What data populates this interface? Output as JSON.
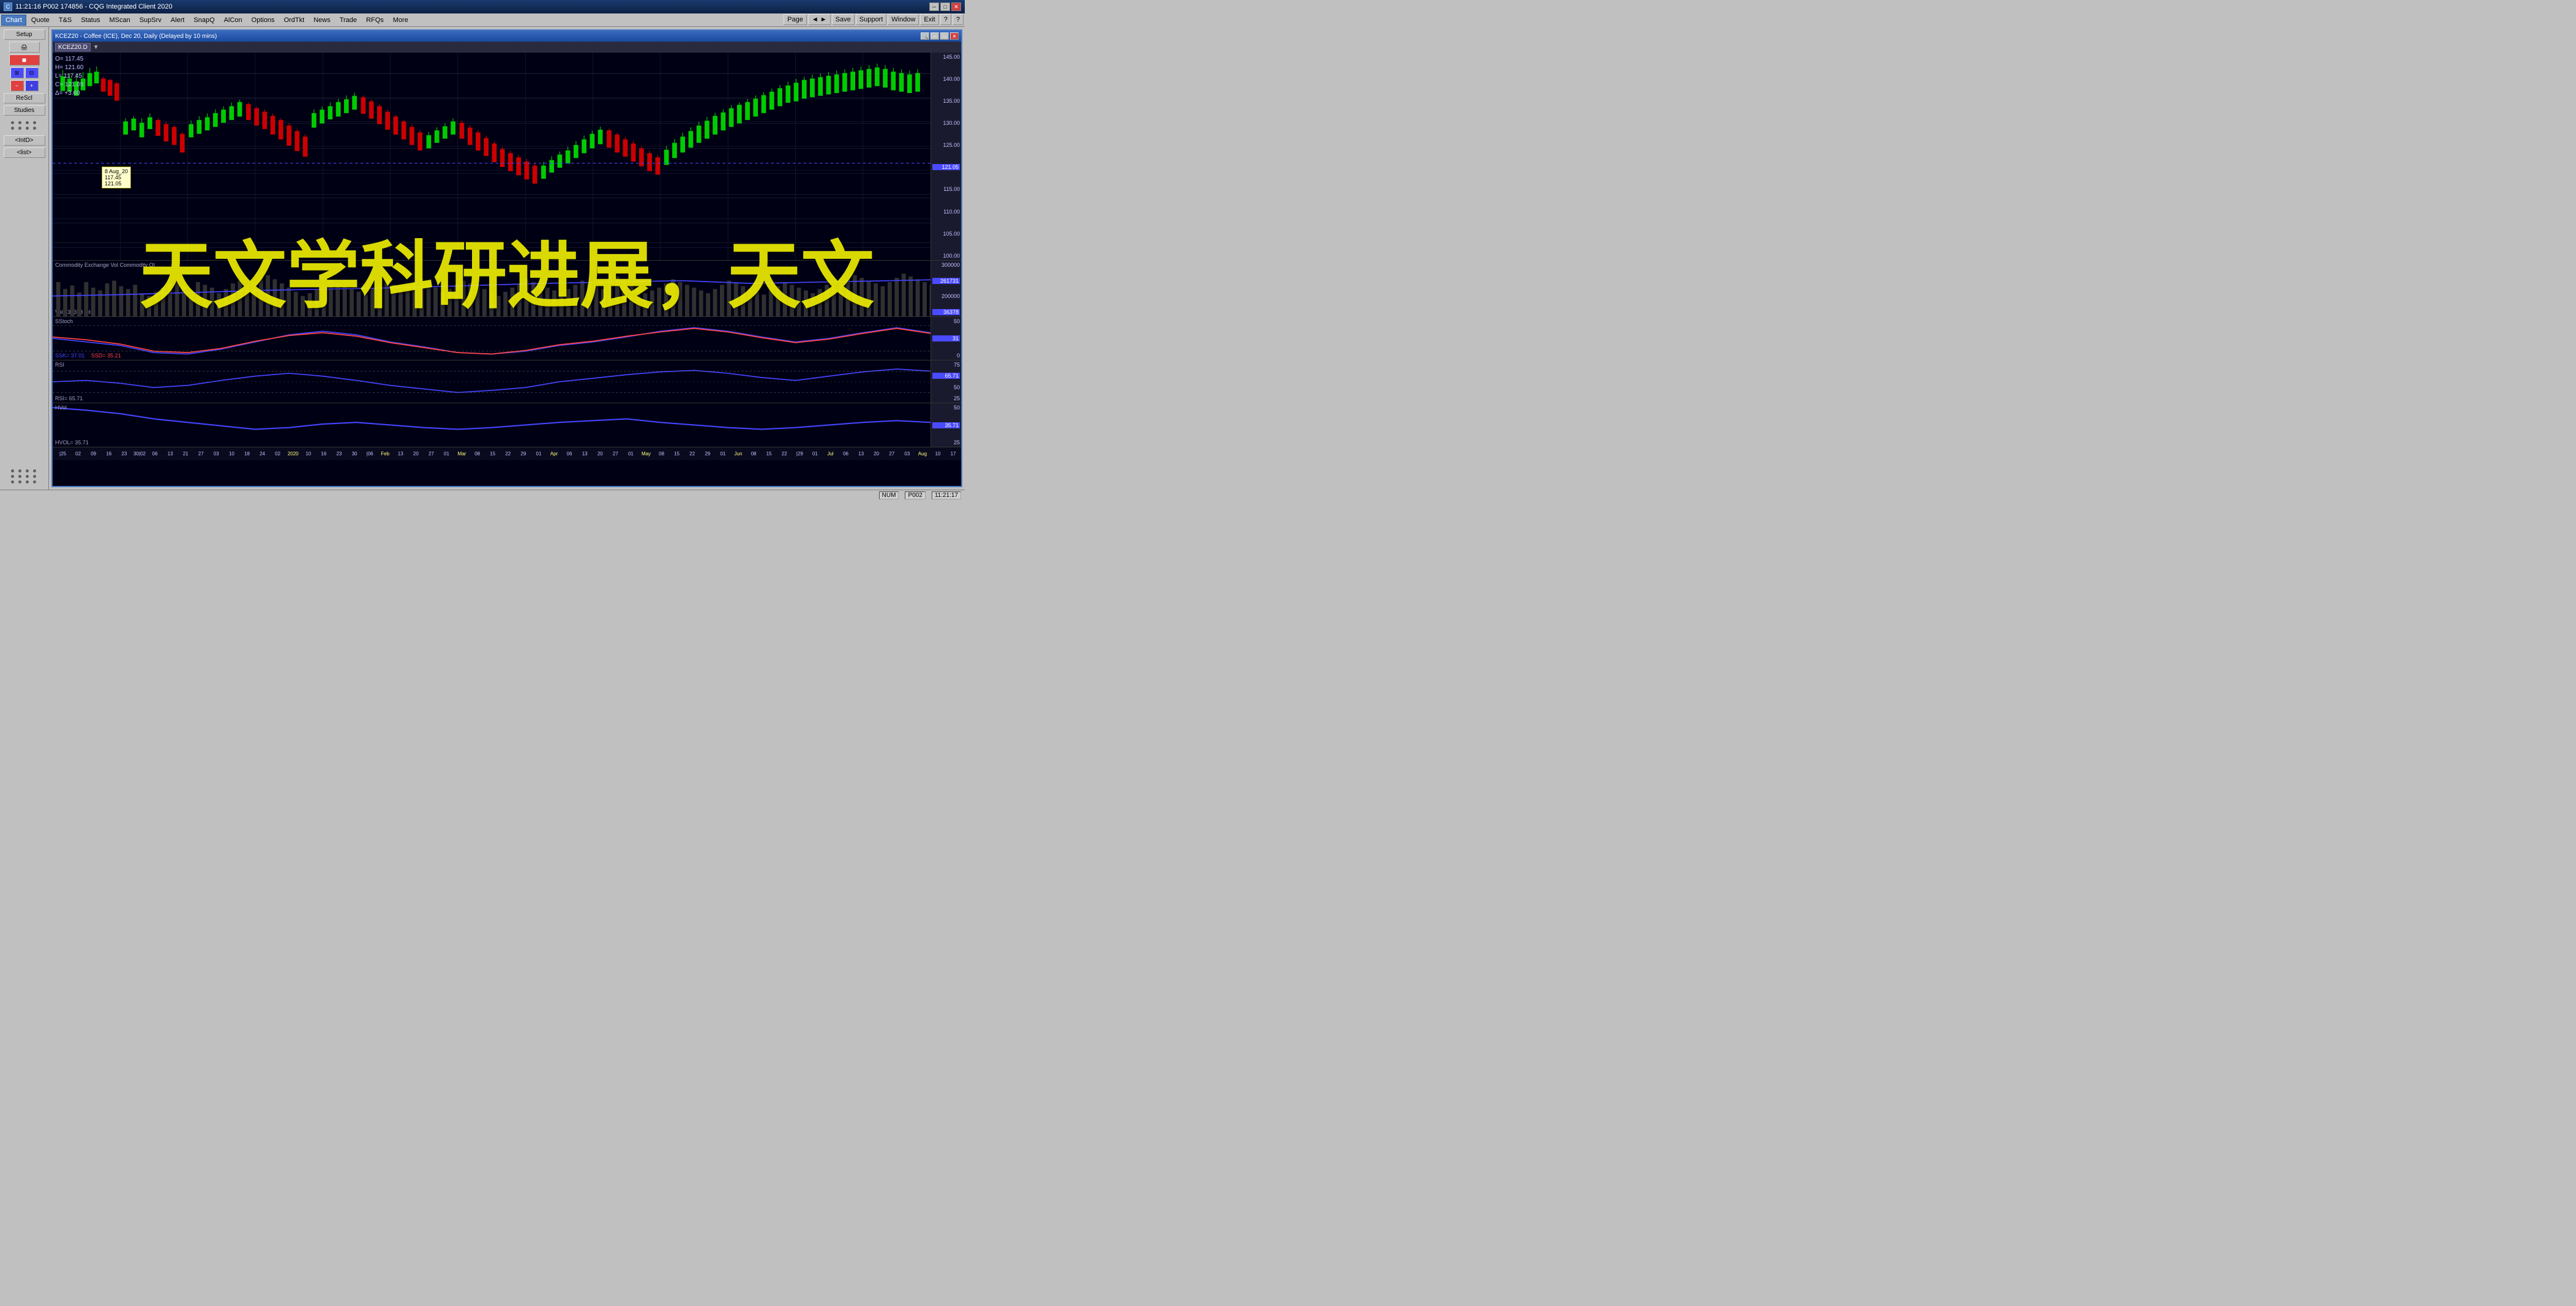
{
  "app": {
    "title": "11:21:16  P002  174856 - CQG Integrated Client 2020",
    "time": "11:21:17",
    "page": "P002",
    "num_indicator": "NUM"
  },
  "menu": {
    "items": [
      {
        "id": "chart",
        "label": "Chart",
        "active": true
      },
      {
        "id": "quote",
        "label": "Quote"
      },
      {
        "id": "ts",
        "label": "T&S"
      },
      {
        "id": "status",
        "label": "Status"
      },
      {
        "id": "mscan",
        "label": "MScan"
      },
      {
        "id": "supsrv",
        "label": "SupSrv"
      },
      {
        "id": "alert",
        "label": "Alert"
      },
      {
        "id": "snapq",
        "label": "SnapQ"
      },
      {
        "id": "alcon",
        "label": "AlCon"
      },
      {
        "id": "options",
        "label": "Options"
      },
      {
        "id": "ordtkt",
        "label": "OrdTkt"
      },
      {
        "id": "news",
        "label": "News"
      },
      {
        "id": "trade",
        "label": "Trade"
      },
      {
        "id": "rfqs",
        "label": "RFQs"
      },
      {
        "id": "more",
        "label": "More"
      }
    ],
    "top_right": [
      "Page",
      "◄ ►",
      "Save",
      "Support",
      "Window",
      "Exit",
      "?",
      "?"
    ]
  },
  "sidebar": {
    "setup_label": "Setup",
    "rescl_label": "ReScl",
    "studies_label": "Studies",
    "intd_label": "<IntD>",
    "list_label": "<list>"
  },
  "chart_window": {
    "title": "KCEZ20 - Coffee (ICE), Dec 20, Daily (Delayed by 10 mins)",
    "symbol": "KCEZ20.D",
    "ohlc": {
      "open": "O= 117.45",
      "high": "H= 121.60",
      "low": "L= 117.45",
      "close": "C= 121.05",
      "delta": "Δ=  +3.60"
    },
    "tooltip": {
      "date": "8 Aug_20",
      "val1": "117.45",
      "val2": "121.05"
    },
    "price_axis": {
      "labels": [
        "145.00",
        "140.00",
        "135.00",
        "130.00",
        "125.00",
        "121.05",
        "115.00",
        "110.00",
        "105.00",
        "100.00"
      ]
    },
    "volume_info": {
      "label": "Commodity Exchange Vol  Commodity OI",
      "vol": "Vol= 36378",
      "oi": "OI=",
      "current_vol": "36378",
      "vol_axis": [
        "300000",
        "261731",
        "200000",
        "36378"
      ]
    },
    "stoch": {
      "label": "SStoch",
      "ssk": "SSK= 37.01",
      "ssd": "SSD= 35.21",
      "axis": [
        "50",
        "31",
        "0"
      ]
    },
    "rsi": {
      "label": "RSI",
      "value": "RSI= 65.71",
      "axis": [
        "75",
        "65.71",
        "50",
        "25"
      ]
    },
    "hvol": {
      "label": "HVol",
      "value": "HVOL= 35.71",
      "axis": [
        "50",
        "35.71",
        "25"
      ]
    },
    "time_axis": [
      "25",
      "02",
      "09",
      "16",
      "23",
      "30",
      "02",
      "06",
      "13",
      "21",
      "27",
      "03",
      "10",
      "18",
      "24",
      "02",
      "10",
      "16",
      "23",
      "30",
      "06",
      "13",
      "20",
      "27",
      "01",
      "08",
      "15",
      "22",
      "29",
      "01",
      "06",
      "13",
      "20",
      "27",
      "03",
      "10",
      "17"
    ],
    "year_labels": [
      "2020",
      "Feb",
      "Mar",
      "Apr",
      "May",
      "Jun",
      "Jul",
      "Aug"
    ]
  },
  "watermark": {
    "text": "天文学科研进展，天文"
  },
  "status_bar": {
    "num": "NUM",
    "page": "P002",
    "time": "11:21:17"
  }
}
